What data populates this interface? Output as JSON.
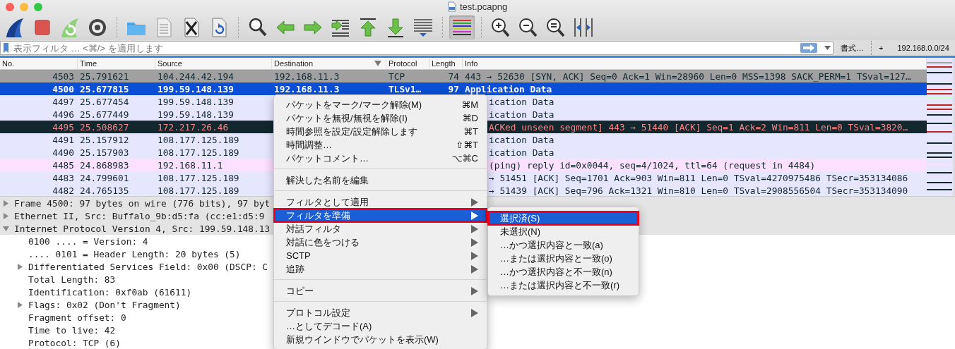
{
  "window": {
    "title": "test.pcapng"
  },
  "toolbar": {
    "groups": [
      [
        {
          "kind": "fin",
          "pressed": false
        },
        {
          "kind": "stop",
          "pressed": false
        },
        {
          "kind": "restart",
          "pressed": false
        },
        {
          "kind": "gear",
          "pressed": false
        }
      ],
      [
        {
          "kind": "folder",
          "pressed": false
        },
        {
          "kind": "document",
          "pressed": false
        },
        {
          "kind": "close-file",
          "pressed": false
        },
        {
          "kind": "reload-file",
          "pressed": false
        }
      ],
      [
        {
          "kind": "search",
          "pressed": false
        },
        {
          "kind": "back",
          "pressed": false
        },
        {
          "kind": "forward",
          "pressed": false
        },
        {
          "kind": "go-to",
          "pressed": false
        },
        {
          "kind": "first",
          "pressed": false
        },
        {
          "kind": "last",
          "pressed": false
        },
        {
          "kind": "autoscroll",
          "pressed": false
        }
      ],
      [
        {
          "kind": "colorize",
          "pressed": true
        }
      ],
      [
        {
          "kind": "zoom-in",
          "pressed": false
        },
        {
          "kind": "zoom-out",
          "pressed": false
        },
        {
          "kind": "zoom-reset",
          "pressed": false
        },
        {
          "kind": "resize-columns",
          "pressed": false
        }
      ]
    ]
  },
  "filter": {
    "placeholder": "表示フィルタ … <⌘/> を適用します"
  },
  "filter_buttons": [
    {
      "label": "書式…"
    },
    {
      "label": "+"
    },
    {
      "label": "192.168.0.0/24"
    }
  ],
  "packet_list": {
    "columns": [
      {
        "label": "No.",
        "sorted": false
      },
      {
        "label": "Time",
        "sorted": false
      },
      {
        "label": "Source",
        "sorted": false
      },
      {
        "label": "Destination",
        "sorted": true
      },
      {
        "label": "Protocol",
        "sorted": false
      },
      {
        "label": "Length",
        "sorted": false
      },
      {
        "label": "Info",
        "sorted": false
      }
    ],
    "rows": [
      {
        "no": "4503",
        "time": "25.791621",
        "source": "104.244.42.194",
        "destination": "192.168.11.3",
        "protocol": "TCP",
        "length": "74",
        "info": "443 → 52630 [SYN, ACK] Seq=0 Ack=1 Win=28960 Len=0 MSS=1398 SACK_PERM=1 TSval=127…",
        "color": "#a0a0a0",
        "kind": "normal",
        "selected": false
      },
      {
        "no": "4500",
        "time": "25.677815",
        "source": "199.59.148.139",
        "destination": "192.168.11.3",
        "protocol": "TLSv1…",
        "length": "97",
        "info": "Application Data",
        "kind": "normal",
        "selected": true
      },
      {
        "no": "4497",
        "time": "25.677454",
        "source": "199.59.148.139",
        "info": "ication Data",
        "color": "#e7e6ff",
        "kind": "normal",
        "selected": false
      },
      {
        "no": "4496",
        "time": "25.677449",
        "source": "199.59.148.139",
        "info": "ication Data",
        "color": "#e7e6ff",
        "kind": "normal",
        "selected": false
      },
      {
        "no": "4495",
        "time": "25.508627",
        "source": "172.217.26.46",
        "info": "ACKed unseen segment] 443 → 51440 [ACK] Seq=1 Ack=2 Win=811 Len=0 TSval=3820…",
        "color": "#12272e",
        "kind": "alert",
        "selected": false
      },
      {
        "no": "4491",
        "time": "25.157912",
        "source": "108.177.125.189",
        "info": "ication Data",
        "color": "#e7e6ff",
        "kind": "normal",
        "selected": false
      },
      {
        "no": "4490",
        "time": "25.157903",
        "source": "108.177.125.189",
        "info": "ication Data",
        "color": "#e7e6ff",
        "kind": "normal",
        "selected": false
      },
      {
        "no": "4485",
        "time": "24.868983",
        "source": "192.168.11.1",
        "info": "(ping) reply    id=0x0044, seq=4/1024, ttl=64 (request in 4484)",
        "color": "#fce0ff",
        "kind": "normal",
        "selected": false
      },
      {
        "no": "4483",
        "time": "24.799601",
        "source": "108.177.125.189",
        "info": "→ 51451 [ACK] Seq=1701 Ack=903 Win=811 Len=0 TSval=4270975486 TSecr=353134086",
        "color": "#e7e6ff",
        "kind": "normal",
        "selected": false
      },
      {
        "no": "4482",
        "time": "24.765135",
        "source": "108.177.125.189",
        "info": "→ 51439 [ACK] Seq=796 Ack=1321 Win=810 Len=0 TSval=2908556504 TSecr=353134090",
        "color": "#e7e6ff",
        "kind": "normal",
        "selected": false
      }
    ]
  },
  "details": [
    {
      "text": "Frame 4500: 97 bytes on wire (776 bits), 97 byt",
      "kind": "branch",
      "expanded": false,
      "selected": true
    },
    {
      "text": "Ethernet II, Src: Buffalo_9b:d5:fa (cc:e1:d5:9",
      "kind": "branch",
      "expanded": false,
      "selected": true
    },
    {
      "text": "Internet Protocol Version 4, Src: 199.59.148.13",
      "kind": "branch",
      "expanded": true,
      "selected": true,
      "children": [
        {
          "text": "0100 .... = Version: 4",
          "kind": "leaf",
          "selected": false
        },
        {
          "text": ".... 0101 = Header Length: 20 bytes (5)",
          "kind": "leaf",
          "selected": false
        },
        {
          "text": "Differentiated Services Field: 0x00 (DSCP: C",
          "kind": "branch",
          "expanded": false,
          "selected": false
        },
        {
          "text": "Total Length: 83",
          "kind": "leaf",
          "selected": false
        },
        {
          "text": "Identification: 0xf0ab (61611)",
          "kind": "leaf",
          "selected": false
        },
        {
          "text": "Flags: 0x02 (Don't Fragment)",
          "kind": "branch",
          "expanded": false,
          "selected": false
        },
        {
          "text": "Fragment offset: 0",
          "kind": "leaf",
          "selected": false
        },
        {
          "text": "Time to live: 42",
          "kind": "leaf",
          "selected": false
        },
        {
          "text": "Protocol: TCP (6)",
          "kind": "leaf",
          "selected": false
        }
      ]
    }
  ],
  "context_menu": {
    "items": [
      {
        "kind": "item",
        "label": "パケットをマーク/マーク解除(M)",
        "shortcut": "⌘M",
        "submenu": false,
        "selected": false,
        "outlined": false
      },
      {
        "kind": "item",
        "label": "パケットを無視/無視を解除(I)",
        "shortcut": "⌘D",
        "submenu": false,
        "selected": false,
        "outlined": false
      },
      {
        "kind": "item",
        "label": "時間参照を設定/設定解除します",
        "shortcut": "⌘T",
        "submenu": false,
        "selected": false,
        "outlined": false
      },
      {
        "kind": "item",
        "label": "時間調整…",
        "shortcut": "⇧⌘T",
        "submenu": false,
        "selected": false,
        "outlined": false
      },
      {
        "kind": "item",
        "label": "パケットコメント…",
        "shortcut": "⌥⌘C",
        "submenu": false,
        "selected": false,
        "outlined": false
      },
      {
        "kind": "separator"
      },
      {
        "kind": "item",
        "label": "解決した名前を編集",
        "submenu": false,
        "selected": false,
        "outlined": false
      },
      {
        "kind": "separator"
      },
      {
        "kind": "item",
        "label": "フィルタとして適用",
        "submenu": true,
        "selected": false,
        "outlined": false
      },
      {
        "kind": "item",
        "label": "フィルタを準備",
        "submenu": true,
        "selected": true,
        "outlined": true
      },
      {
        "kind": "item",
        "label": "対話フィルタ",
        "submenu": true,
        "selected": false,
        "outlined": false
      },
      {
        "kind": "item",
        "label": "対話に色をつける",
        "submenu": true,
        "selected": false,
        "outlined": false
      },
      {
        "kind": "item",
        "label": "SCTP",
        "submenu": true,
        "selected": false,
        "outlined": false
      },
      {
        "kind": "item",
        "label": "追跡",
        "submenu": true,
        "selected": false,
        "outlined": false
      },
      {
        "kind": "separator"
      },
      {
        "kind": "item",
        "label": "コピー",
        "submenu": true,
        "selected": false,
        "outlined": false
      },
      {
        "kind": "separator"
      },
      {
        "kind": "item",
        "label": "プロトコル設定",
        "submenu": true,
        "selected": false,
        "outlined": false
      },
      {
        "kind": "item",
        "label": "…としてデコード(A)",
        "submenu": false,
        "selected": false,
        "outlined": false
      },
      {
        "kind": "item",
        "label": "新規ウインドウでパケットを表示(W)",
        "submenu": false,
        "selected": false,
        "outlined": false
      }
    ]
  },
  "submenu": {
    "items": [
      {
        "label": "選択済(S)",
        "selected": true,
        "outlined": true
      },
      {
        "label": "未選択(N)",
        "selected": false,
        "outlined": false
      },
      {
        "label": "…かつ選択内容と一致(a)",
        "selected": false,
        "outlined": false
      },
      {
        "label": "…または選択内容と一致(o)",
        "selected": false,
        "outlined": false
      },
      {
        "label": "…かつ選択内容と不一致(n)",
        "selected": false,
        "outlined": false
      },
      {
        "label": "…または選択内容と不一致(r)",
        "selected": false,
        "outlined": false
      }
    ]
  }
}
